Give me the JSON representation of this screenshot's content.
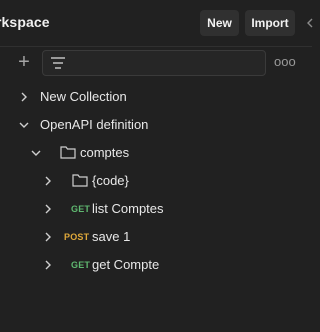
{
  "header": {
    "workspace_title": "rkspace",
    "new_label": "New",
    "import_label": "Import"
  },
  "tree": {
    "collection_1": "New Collection",
    "collection_2": "OpenAPI definition",
    "folder_comptes": "comptes",
    "folder_code": "{code}",
    "req_1": {
      "method": "GET",
      "label": "list Comptes"
    },
    "req_2": {
      "method": "POST",
      "label": "save 1"
    },
    "req_3": {
      "method": "GET",
      "label": "get Compte"
    }
  },
  "colors": {
    "background": "#212121",
    "get_method": "#5fb870",
    "post_method": "#e0a93a"
  },
  "icons": [
    "plus-icon",
    "filter-icon",
    "more-icon",
    "chevron-right-icon",
    "chevron-down-icon",
    "folder-icon"
  ]
}
